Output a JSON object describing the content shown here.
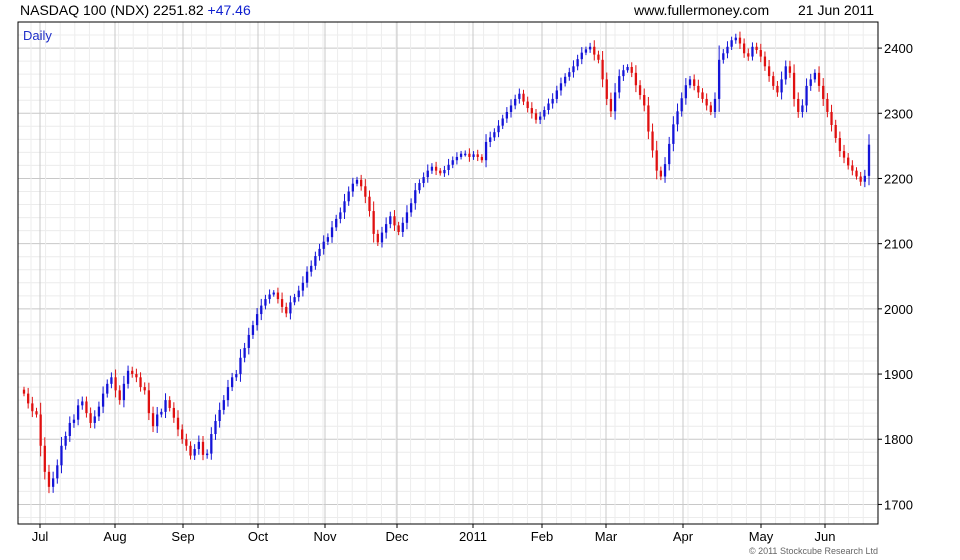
{
  "header": {
    "symbol": "NASDAQ 100 (NDX)",
    "last": "2251.82",
    "change": "+47.46",
    "site": "www.fullermoney.com",
    "date": "21 Jun 2011"
  },
  "copyright": "© 2011 Stockcube Research Ltd",
  "chart_data": {
    "type": "candlestick",
    "frequency_label": "Daily",
    "colors": {
      "up": "#1414d8",
      "down": "#e01010",
      "grid": "#dcdcdc",
      "frame": "#000000"
    },
    "y_axis": {
      "position": "right",
      "range": [
        1670,
        2440
      ],
      "ticks": [
        1700,
        1800,
        1900,
        2000,
        2100,
        2200,
        2300,
        2400
      ]
    },
    "x_axis": {
      "labels": [
        "Jul",
        "Aug",
        "Sep",
        "Oct",
        "Nov",
        "Dec",
        "2011",
        "Feb",
        "Mar",
        "Apr",
        "May",
        "Jun"
      ]
    },
    "grid": true,
    "closes": [
      1870,
      1855,
      1843,
      1838,
      1790,
      1750,
      1727,
      1740,
      1760,
      1790,
      1805,
      1825,
      1830,
      1852,
      1858,
      1840,
      1825,
      1835,
      1850,
      1870,
      1885,
      1895,
      1875,
      1860,
      1885,
      1905,
      1900,
      1895,
      1880,
      1875,
      1840,
      1820,
      1838,
      1842,
      1860,
      1848,
      1833,
      1815,
      1800,
      1790,
      1775,
      1785,
      1796,
      1776,
      1778,
      1808,
      1828,
      1845,
      1860,
      1880,
      1895,
      1900,
      1925,
      1940,
      1960,
      1975,
      1992,
      2005,
      2015,
      2022,
      2025,
      2015,
      2003,
      1993,
      2010,
      2018,
      2028,
      2040,
      2057,
      2066,
      2081,
      2092,
      2103,
      2110,
      2125,
      2138,
      2148,
      2165,
      2180,
      2192,
      2198,
      2188,
      2172,
      2150,
      2115,
      2102,
      2117,
      2130,
      2142,
      2128,
      2118,
      2132,
      2148,
      2162,
      2182,
      2193,
      2202,
      2212,
      2218,
      2212,
      2208,
      2213,
      2221,
      2228,
      2233,
      2238,
      2238,
      2233,
      2237,
      2233,
      2228,
      2256,
      2263,
      2271,
      2281,
      2292,
      2302,
      2312,
      2322,
      2330,
      2318,
      2308,
      2300,
      2290,
      2295,
      2305,
      2315,
      2322,
      2335,
      2346,
      2356,
      2363,
      2372,
      2383,
      2393,
      2398,
      2402,
      2390,
      2382,
      2352,
      2322,
      2303,
      2332,
      2357,
      2366,
      2371,
      2362,
      2343,
      2328,
      2312,
      2272,
      2243,
      2212,
      2203,
      2222,
      2253,
      2283,
      2303,
      2323,
      2343,
      2352,
      2342,
      2332,
      2322,
      2312,
      2302,
      2322,
      2382,
      2392,
      2402,
      2412,
      2416,
      2407,
      2392,
      2387,
      2402,
      2397,
      2387,
      2372,
      2357,
      2342,
      2332,
      2352,
      2372,
      2362,
      2322,
      2302,
      2312,
      2342,
      2352,
      2362,
      2342,
      2322,
      2302,
      2282,
      2262,
      2242,
      2232,
      2220,
      2212,
      2203,
      2195,
      2204,
      2251.82
    ]
  }
}
